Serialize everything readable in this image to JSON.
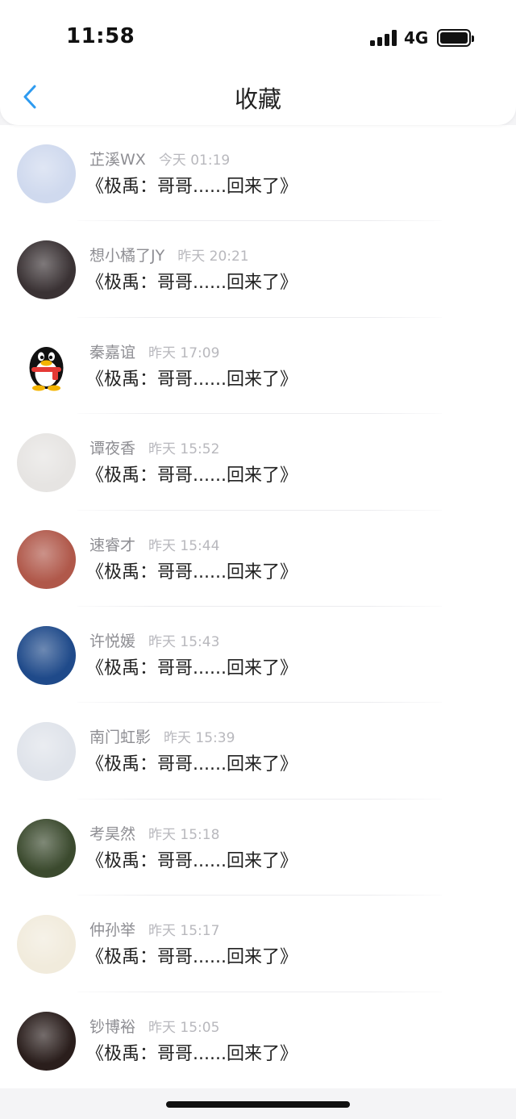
{
  "status_bar": {
    "time": "11:58",
    "network": "4G"
  },
  "nav": {
    "title": "收藏"
  },
  "items": [
    {
      "name": "芷溪WX",
      "time": "今天 01:19",
      "message": "《极禹：哥哥......回来了》",
      "avatar_color": "#cfd9ee"
    },
    {
      "name": "想小橘了JY",
      "time": "昨天 20:21",
      "message": "《极禹：哥哥......回来了》",
      "avatar_color": "#3a3234"
    },
    {
      "name": "秦嘉谊",
      "time": "昨天 17:09",
      "message": "《极禹：哥哥......回来了》",
      "avatar_color": "#ffffff"
    },
    {
      "name": "谭夜香",
      "time": "昨天 15:52",
      "message": "《极禹：哥哥......回来了》",
      "avatar_color": "#e6e4e2"
    },
    {
      "name": "速睿才",
      "time": "昨天 15:44",
      "message": "《极禹：哥哥......回来了》",
      "avatar_color": "#b0584a"
    },
    {
      "name": "许悦媛",
      "time": "昨天 15:43",
      "message": "《极禹：哥哥......回来了》",
      "avatar_color": "#1f4a8a"
    },
    {
      "name": "南门虹影",
      "time": "昨天 15:39",
      "message": "《极禹：哥哥......回来了》",
      "avatar_color": "#dfe3ea"
    },
    {
      "name": "考昊然",
      "time": "昨天 15:18",
      "message": "《极禹：哥哥......回来了》",
      "avatar_color": "#3b4a2e"
    },
    {
      "name": "仲孙举",
      "time": "昨天 15:17",
      "message": "《极禹：哥哥......回来了》",
      "avatar_color": "#f1ebdc"
    },
    {
      "name": "钞博裕",
      "time": "昨天 15:05",
      "message": "《极禹：哥哥......回来了》",
      "avatar_color": "#2a1e1c"
    }
  ]
}
